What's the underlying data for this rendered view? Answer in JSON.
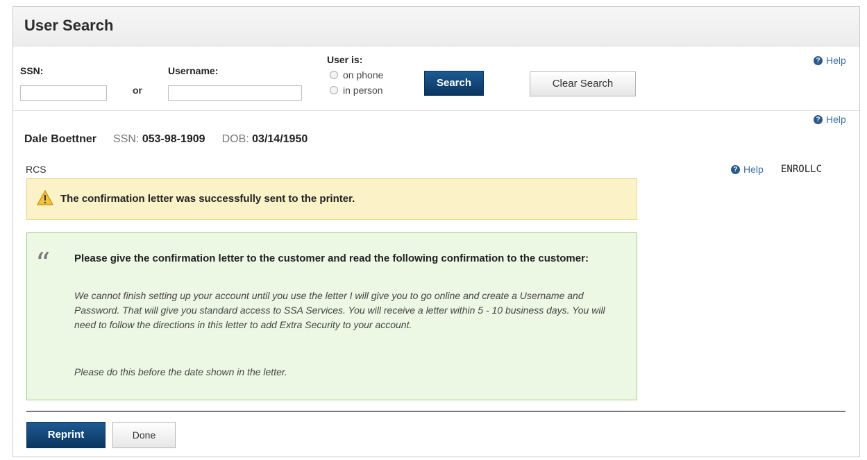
{
  "clipped_title": "",
  "header": {
    "title": "User Search"
  },
  "search": {
    "ssn_label": "SSN:",
    "or_label": "or",
    "username_label": "Username:",
    "ssn_value": "",
    "username_value": "",
    "user_is_label": "User is:",
    "options": [
      "on phone",
      "in person"
    ],
    "search_button": "Search",
    "clear_button": "Clear Search",
    "help": "Help"
  },
  "user": {
    "help": "Help",
    "name": "Dale Boettner",
    "ssn_label": "SSN:",
    "ssn": "053-98-1909",
    "dob_label": "DOB:",
    "dob": "03/14/1950"
  },
  "section": {
    "code": "RCS",
    "help": "Help",
    "page_id": "ENROLLC"
  },
  "alert": {
    "message": "The confirmation letter was successfully sent to the printer."
  },
  "script": {
    "heading": "Please give the confirmation letter to the customer and read the following confirmation to the customer:",
    "body": "We cannot finish setting up your account until you use the letter I will give you to go online and create a Username and Password. That will give you standard access to SSA Services. You will receive a letter within 5 - 10 business days. You will need to follow the directions in this letter to add Extra Security to your account.",
    "tail": "Please do this before the date shown in the letter."
  },
  "actions": {
    "reprint": "Reprint",
    "done": "Done"
  },
  "colors": {
    "primary": "#0a355f",
    "warn_bg": "#fbf2c8",
    "success_bg": "#ecf7e4",
    "link": "#3b6ea5"
  }
}
